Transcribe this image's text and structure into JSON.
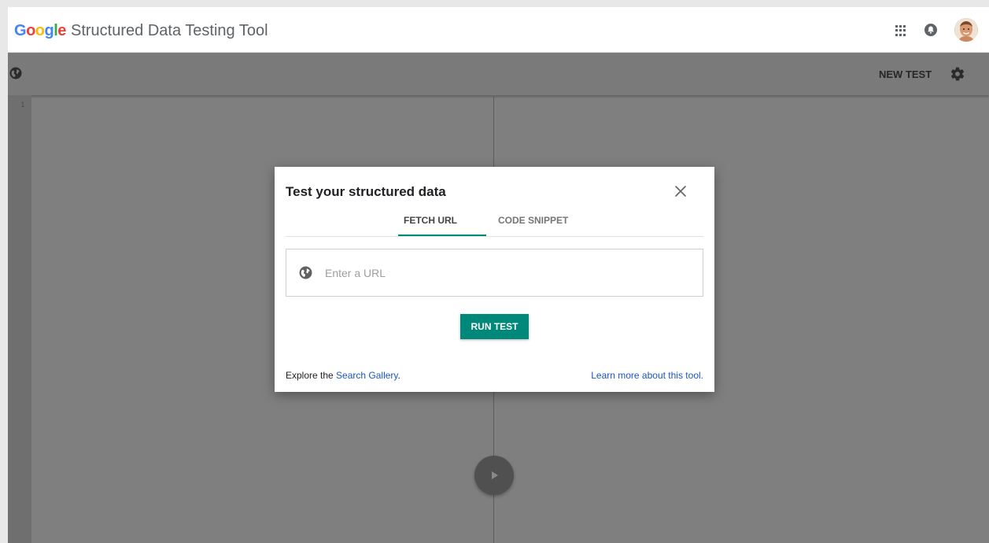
{
  "header": {
    "logo_letters": [
      "G",
      "o",
      "o",
      "g",
      "l",
      "e"
    ],
    "app_title": "Structured Data Testing Tool",
    "apps_icon": "apps-grid-icon",
    "notifications_icon": "notifications-icon",
    "avatar": "user-avatar"
  },
  "toolbar": {
    "left_icon": "globe-icon",
    "new_test_label": "NEW TEST",
    "settings_icon": "gear-icon"
  },
  "editor": {
    "line_numbers": [
      "1"
    ],
    "run_icon": "play-icon"
  },
  "dialog": {
    "title": "Test your structured data",
    "close_icon": "close-icon",
    "tabs": [
      {
        "label": "FETCH URL",
        "active": true
      },
      {
        "label": "CODE SNIPPET",
        "active": false
      }
    ],
    "url_field": {
      "icon": "globe-icon",
      "placeholder": "Enter a URL",
      "value": ""
    },
    "run_button_label": "RUN TEST",
    "footer": {
      "explore_prefix": "Explore the ",
      "explore_link": "Search Gallery",
      "explore_suffix": ".",
      "learn_link": "Learn more about this tool."
    }
  },
  "colors": {
    "accent": "#00897b",
    "link": "#1a55c4",
    "overlay": "#7f7f7f"
  }
}
